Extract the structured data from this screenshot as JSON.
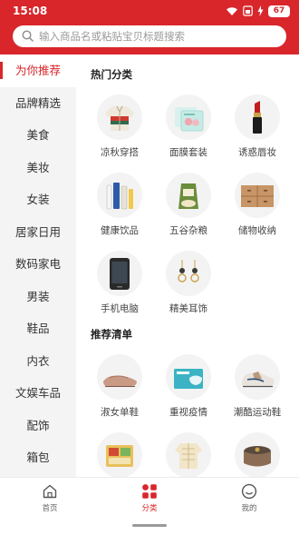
{
  "status": {
    "time": "15:08",
    "battery": "67"
  },
  "search": {
    "placeholder": "输入商品名或粘贴宝贝标题搜索"
  },
  "sidebar": {
    "items": [
      {
        "label": "为你推荐",
        "active": true
      },
      {
        "label": "品牌精选"
      },
      {
        "label": "美食"
      },
      {
        "label": "美妆"
      },
      {
        "label": "女装"
      },
      {
        "label": "居家日用"
      },
      {
        "label": "数码家电"
      },
      {
        "label": "男装"
      },
      {
        "label": "鞋品"
      },
      {
        "label": "内衣"
      },
      {
        "label": "文娱车品"
      },
      {
        "label": "配饰"
      },
      {
        "label": "箱包"
      }
    ]
  },
  "sections": {
    "hot": {
      "title": "热门分类",
      "items": [
        {
          "label": "凉秋穿搭",
          "icon": "jacket-icon"
        },
        {
          "label": "面膜套装",
          "icon": "face-mask-icon"
        },
        {
          "label": "诱惑唇妆",
          "icon": "lipstick-icon"
        },
        {
          "label": "健康饮品",
          "icon": "drinks-icon"
        },
        {
          "label": "五谷杂粮",
          "icon": "grain-sack-icon"
        },
        {
          "label": "储物收纳",
          "icon": "drawer-cabinet-icon"
        },
        {
          "label": "手机电脑",
          "icon": "phone-icon"
        },
        {
          "label": "精美耳饰",
          "icon": "earrings-icon"
        }
      ]
    },
    "recommend": {
      "title": "推荐清单",
      "items": [
        {
          "label": "淑女单鞋",
          "icon": "flat-shoe-icon"
        },
        {
          "label": "重视疫情",
          "icon": "mask-box-icon"
        },
        {
          "label": "潮酷运动鞋",
          "icon": "sneaker-icon"
        },
        {
          "label": "",
          "icon": "snack-box-icon"
        },
        {
          "label": "",
          "icon": "pajamas-icon"
        },
        {
          "label": "",
          "icon": "rice-cooker-icon"
        }
      ]
    }
  },
  "bottom_nav": [
    {
      "label": "首页",
      "icon": "home-icon"
    },
    {
      "label": "分类",
      "icon": "category-icon",
      "active": true
    },
    {
      "label": "我的",
      "icon": "profile-icon"
    }
  ],
  "colors": {
    "accent": "#d8262b",
    "sidebar_bg": "#f4f4f4"
  }
}
